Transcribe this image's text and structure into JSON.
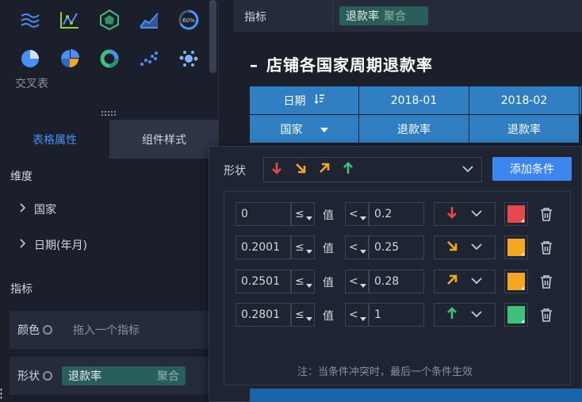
{
  "left_panel": {
    "chart_icons": [
      "multi-line-chart-icon",
      "line-scatter-chart-icon",
      "radar-chart-icon",
      "area-chart-icon",
      "gauge-chart-icon",
      "pie-chart-icon",
      "quadrant-pie-chart-icon",
      "donut-chart-icon",
      "scatter-chart-icon",
      "bubble-chart-icon"
    ],
    "gauge_text": "60%",
    "cross_table_label": "交叉表",
    "tabs": [
      {
        "label": "表格属性",
        "active": true
      },
      {
        "label": "组件样式",
        "active": false
      }
    ],
    "dimension_title": "维度",
    "dimensions": [
      "国家",
      "日期(年月)"
    ],
    "metric_title": "指标",
    "color_row": {
      "label": "颜色",
      "placeholder": "拖入一个指标"
    },
    "shape_row": {
      "label": "形状",
      "field": "退款率",
      "agg": "聚合"
    }
  },
  "top_bar": {
    "label": "指标",
    "field": "退款率",
    "agg": "聚合"
  },
  "chart": {
    "title": "店铺各国家周期退款率",
    "header_row1": [
      "日期",
      "2018-01",
      "2018-02"
    ],
    "header_row2": [
      "国家",
      "退款率",
      "退款率"
    ]
  },
  "popup": {
    "shape_label": "形状",
    "shape_options": [
      "down",
      "down-right",
      "up-right",
      "up"
    ],
    "add_button": "添加条件",
    "value_label": "值",
    "rules": [
      {
        "from": "0",
        "op1": "≤",
        "op2": "<",
        "to": "0.2",
        "arrow": "down",
        "color": "#e5484d"
      },
      {
        "from": "0.2001",
        "op1": "≤",
        "op2": "<",
        "to": "0.25",
        "arrow": "down-right",
        "color": "#f5a623"
      },
      {
        "from": "0.2501",
        "op1": "≤",
        "op2": "<",
        "to": "0.28",
        "arrow": "up-right",
        "color": "#f5a623"
      },
      {
        "from": "0.2801",
        "op1": "≤",
        "op2": "<",
        "to": "1",
        "arrow": "up",
        "color": "#3ec27a"
      }
    ],
    "note": "注：当条件冲突时，最后一个条件生效"
  },
  "colors": {
    "red": "#e5484d",
    "orange": "#f5a623",
    "green": "#3ec27a",
    "accent": "#3d86f0",
    "table_header": "#2f7fc2"
  }
}
